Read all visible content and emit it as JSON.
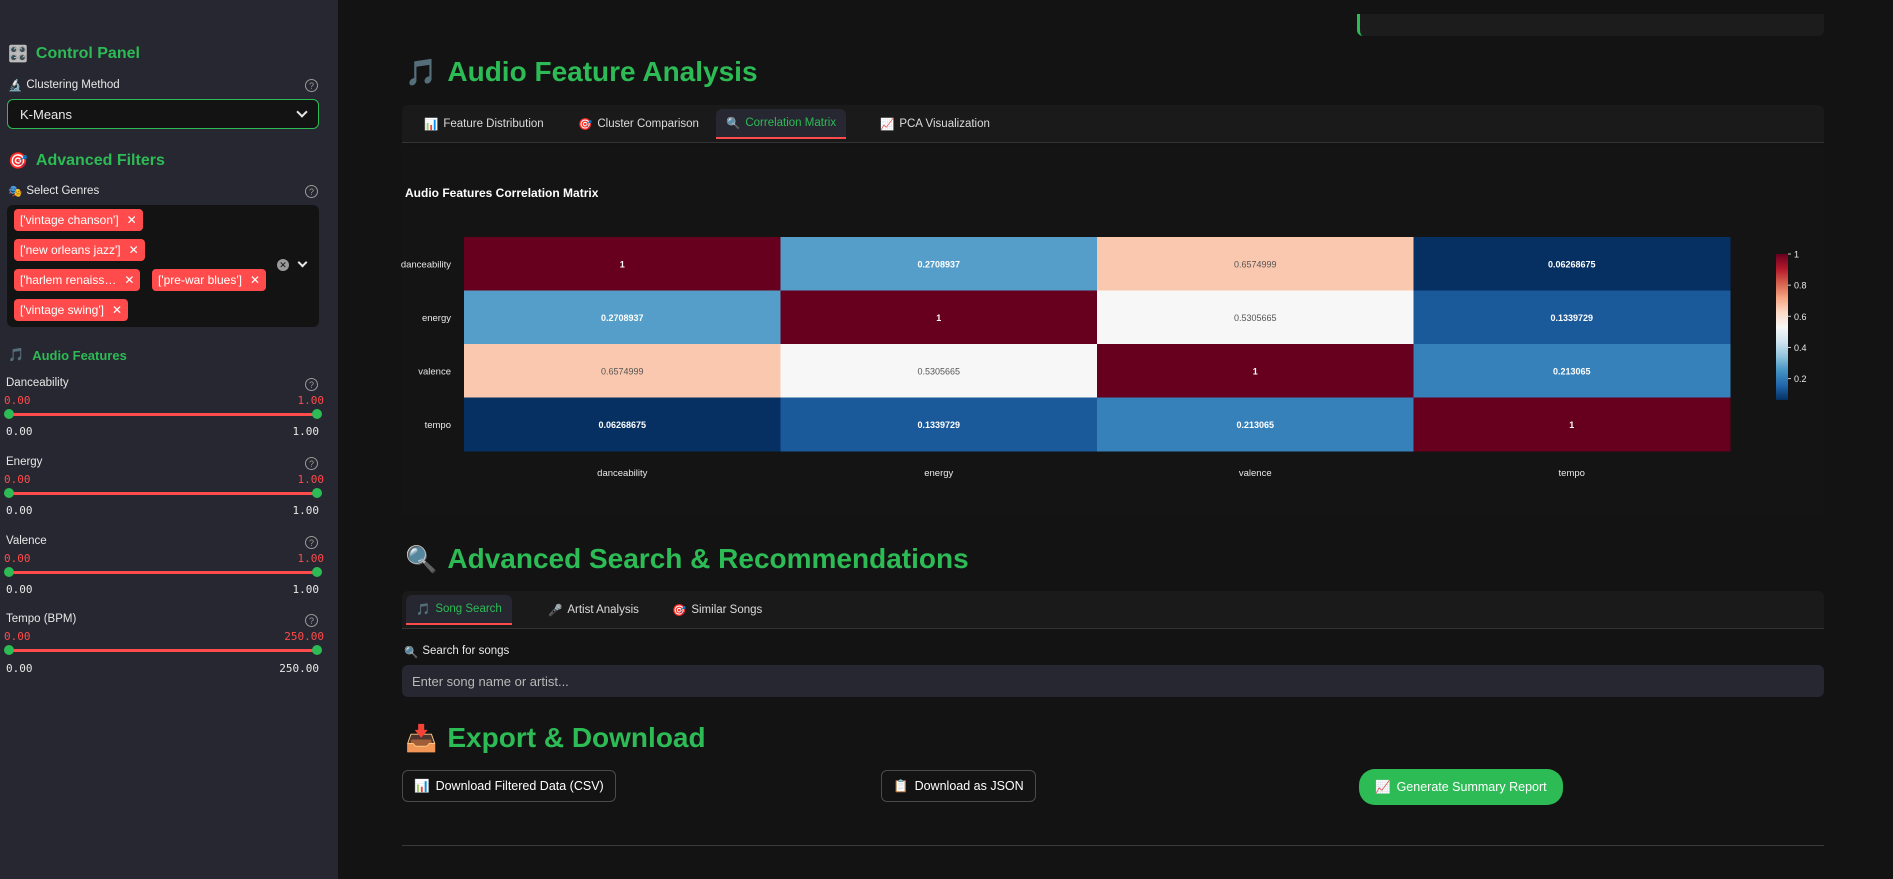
{
  "sidebar": {
    "control_panel_icon": "🎛️",
    "control_panel_title": "Control Panel",
    "clustering_icon": "🔬",
    "clustering_label": "Clustering Method",
    "clustering_value": "K-Means",
    "advanced_filters_icon": "🎯",
    "advanced_filters_title": "Advanced Filters",
    "genres_icon": "🎭",
    "genres_label": "Select Genres",
    "genres": [
      "['vintage chanson']",
      "['new orleans jazz']",
      "['harlem renaiss…",
      "['pre-war blues']",
      "['vintage swing']"
    ],
    "audio_features_icon": "🎵",
    "audio_features_title": "Audio Features",
    "sliders": [
      {
        "name": "Danceability",
        "min_label": "0.00",
        "max_label": "1.00",
        "range_min": "0.00",
        "range_max": "1.00"
      },
      {
        "name": "Energy",
        "min_label": "0.00",
        "max_label": "1.00",
        "range_min": "0.00",
        "range_max": "1.00"
      },
      {
        "name": "Valence",
        "min_label": "0.00",
        "max_label": "1.00",
        "range_min": "0.00",
        "range_max": "1.00"
      },
      {
        "name": "Tempo (BPM)",
        "min_label": "0.00",
        "max_label": "250.00",
        "range_min": "0.00",
        "range_max": "250.00"
      }
    ]
  },
  "analysis": {
    "icon": "🎵",
    "title": "Audio Feature Analysis",
    "tabs": [
      {
        "icon": "📊",
        "label": "Feature Distribution"
      },
      {
        "icon": "🎯",
        "label": "Cluster Comparison"
      },
      {
        "icon": "🔍",
        "label": "Correlation Matrix"
      },
      {
        "icon": "📈",
        "label": "PCA Visualization"
      }
    ],
    "active_tab": 2
  },
  "chart_data": {
    "type": "heatmap",
    "title": "Audio Features Correlation Matrix",
    "x": [
      "danceability",
      "energy",
      "valence",
      "tempo"
    ],
    "y": [
      "danceability",
      "energy",
      "valence",
      "tempo"
    ],
    "z": [
      [
        1,
        0.2708937,
        0.6574999,
        0.06268675
      ],
      [
        0.2708937,
        1,
        0.5305665,
        0.1339729
      ],
      [
        0.6574999,
        0.5305665,
        1,
        0.213065
      ],
      [
        0.06268675,
        0.1339729,
        0.213065,
        1
      ]
    ],
    "colorscale": "RdBu_r",
    "colorbar_ticks": [
      "1",
      "0.8",
      "0.6",
      "0.4",
      "0.2"
    ]
  },
  "search": {
    "icon": "🔍",
    "title": "Advanced Search & Recommendations",
    "tabs": [
      {
        "icon": "🎵",
        "label": "Song Search"
      },
      {
        "icon": "🎤",
        "label": "Artist Analysis"
      },
      {
        "icon": "🎯",
        "label": "Similar Songs"
      }
    ],
    "field_icon": "🔍",
    "field_label": "Search for songs",
    "placeholder": "Enter song name or artist..."
  },
  "export": {
    "icon": "📥",
    "title": "Export & Download",
    "csv_icon": "📊",
    "csv_label": "Download Filtered Data (CSV)",
    "json_icon": "📋",
    "json_label": "Download as JSON",
    "report_icon": "📈",
    "report_label": "Generate Summary Report"
  },
  "colors": {
    "accent": "#2dbb55",
    "danger": "#ff4b4b"
  }
}
